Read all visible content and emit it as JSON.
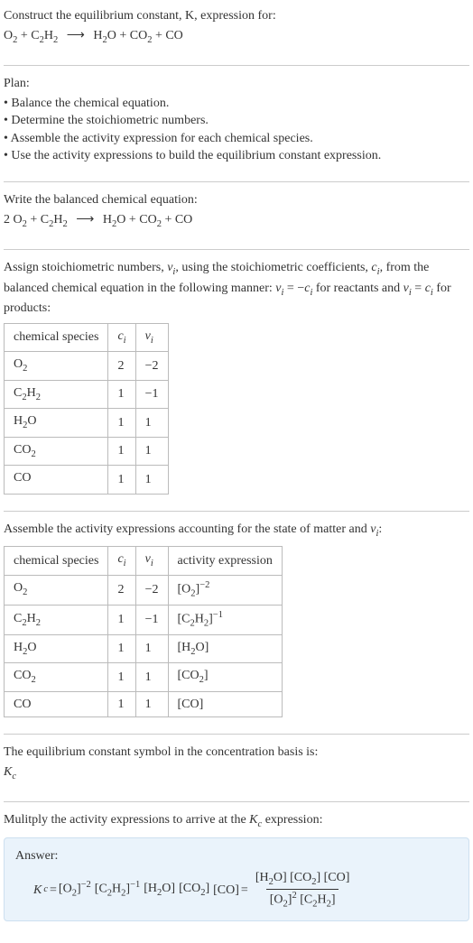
{
  "intro": {
    "line1": "Construct the equilibrium constant, K, expression for:",
    "equation_lhs1": "O",
    "equation_lhs1_sub": "2",
    "equation_plus1": " + ",
    "equation_lhs2": "C",
    "equation_lhs2_sub1": "2",
    "equation_lhs2_mid": "H",
    "equation_lhs2_sub2": "2",
    "arrow": "⟶",
    "equation_rhs1": "H",
    "equation_rhs1_sub": "2",
    "equation_rhs1_tail": "O",
    "equation_plus2": " + ",
    "equation_rhs2": "CO",
    "equation_rhs2_sub": "2",
    "equation_plus3": " + ",
    "equation_rhs3": "CO"
  },
  "plan": {
    "heading": "Plan:",
    "items": [
      "Balance the chemical equation.",
      "Determine the stoichiometric numbers.",
      "Assemble the activity expression for each chemical species.",
      "Use the activity expressions to build the equilibrium constant expression."
    ]
  },
  "balanced": {
    "heading": "Write the balanced chemical equation:",
    "coef1": "2 ",
    "o2": "O",
    "o2_sub": "2",
    "plus1": " + ",
    "c2h2_c": "C",
    "c2h2_s1": "2",
    "c2h2_h": "H",
    "c2h2_s2": "2",
    "arrow": "⟶",
    "h2o_h": "H",
    "h2o_s": "2",
    "h2o_o": "O",
    "plus2": " + ",
    "co2": "CO",
    "co2_sub": "2",
    "plus3": " + ",
    "co": "CO"
  },
  "assign": {
    "text_a": "Assign stoichiometric numbers, ",
    "nu_i": "ν",
    "nu_sub": "i",
    "text_b": ", using the stoichiometric coefficients, ",
    "c_i": "c",
    "c_sub": "i",
    "text_c": ", from the balanced chemical equation in the following manner: ",
    "eq1_l": "ν",
    "eq1_ls": "i",
    "eq1_m": " = −",
    "eq1_r": "c",
    "eq1_rs": "i",
    "text_d": " for reactants and ",
    "eq2_l": "ν",
    "eq2_ls": "i",
    "eq2_m": " = ",
    "eq2_r": "c",
    "eq2_rs": "i",
    "text_e": " for products:"
  },
  "table1": {
    "h1": "chemical species",
    "h2": "c",
    "h2_sub": "i",
    "h3": "ν",
    "h3_sub": "i",
    "rows": [
      {
        "sp_a": "O",
        "sp_s1": "2",
        "sp_b": "",
        "sp_s2": "",
        "c": "2",
        "nu": "−2"
      },
      {
        "sp_a": "C",
        "sp_s1": "2",
        "sp_b": "H",
        "sp_s2": "2",
        "c": "1",
        "nu": "−1"
      },
      {
        "sp_a": "H",
        "sp_s1": "2",
        "sp_b": "O",
        "sp_s2": "",
        "c": "1",
        "nu": "1"
      },
      {
        "sp_a": "CO",
        "sp_s1": "2",
        "sp_b": "",
        "sp_s2": "",
        "c": "1",
        "nu": "1"
      },
      {
        "sp_a": "CO",
        "sp_s1": "",
        "sp_b": "",
        "sp_s2": "",
        "c": "1",
        "nu": "1"
      }
    ]
  },
  "assemble": {
    "text_a": "Assemble the activity expressions accounting for the state of matter and ",
    "nu": "ν",
    "nu_sub": "i",
    "text_b": ":"
  },
  "table2": {
    "h1": "chemical species",
    "h2": "c",
    "h2_sub": "i",
    "h3": "ν",
    "h3_sub": "i",
    "h4": "activity expression",
    "rows": [
      {
        "sp_a": "O",
        "sp_s1": "2",
        "sp_b": "",
        "sp_s2": "",
        "c": "2",
        "nu": "−2",
        "ae_pre": "[O",
        "ae_s": "2",
        "ae_post": "]",
        "ae_exp": "−2"
      },
      {
        "sp_a": "C",
        "sp_s1": "2",
        "sp_b": "H",
        "sp_s2": "2",
        "c": "1",
        "nu": "−1",
        "ae_pre": "[C",
        "ae_s": "2",
        "ae_mid": "H",
        "ae_s2": "2",
        "ae_post": "]",
        "ae_exp": "−1"
      },
      {
        "sp_a": "H",
        "sp_s1": "2",
        "sp_b": "O",
        "sp_s2": "",
        "c": "1",
        "nu": "1",
        "ae_pre": "[H",
        "ae_s": "2",
        "ae_post": "O]",
        "ae_exp": ""
      },
      {
        "sp_a": "CO",
        "sp_s1": "2",
        "sp_b": "",
        "sp_s2": "",
        "c": "1",
        "nu": "1",
        "ae_pre": "[CO",
        "ae_s": "2",
        "ae_post": "]",
        "ae_exp": ""
      },
      {
        "sp_a": "CO",
        "sp_s1": "",
        "sp_b": "",
        "sp_s2": "",
        "c": "1",
        "nu": "1",
        "ae_pre": "[CO]",
        "ae_s": "",
        "ae_post": "",
        "ae_exp": ""
      }
    ]
  },
  "basis": {
    "line": "The equilibrium constant symbol in the concentration basis is:",
    "K": "K",
    "K_sub": "c"
  },
  "multiply": {
    "text_a": "Mulitply the activity expressions to arrive at the ",
    "K": "K",
    "K_sub": "c",
    "text_b": " expression:"
  },
  "answer": {
    "label": "Answer:",
    "K": "K",
    "K_sub": "c",
    "eq": " = ",
    "t1_a": "[O",
    "t1_s": "2",
    "t1_b": "]",
    "t1_exp": "−2",
    "sp1": " ",
    "t2_a": "[C",
    "t2_s1": "2",
    "t2_m": "H",
    "t2_s2": "2",
    "t2_b": "]",
    "t2_exp": "−1",
    "sp2": " ",
    "t3_a": "[H",
    "t3_s": "2",
    "t3_b": "O]",
    "sp3": " ",
    "t4_a": "[CO",
    "t4_s": "2",
    "t4_b": "]",
    "sp4": " ",
    "t5": "[CO]",
    "eq2": " = ",
    "num_a": "[H",
    "num_s1": "2",
    "num_b": "O] [CO",
    "num_s2": "2",
    "num_c": "] [CO]",
    "den_a": "[O",
    "den_s1": "2",
    "den_b": "]",
    "den_exp": "2",
    "den_sp": " [C",
    "den_s2": "2",
    "den_m": "H",
    "den_s3": "2",
    "den_c": "]"
  }
}
